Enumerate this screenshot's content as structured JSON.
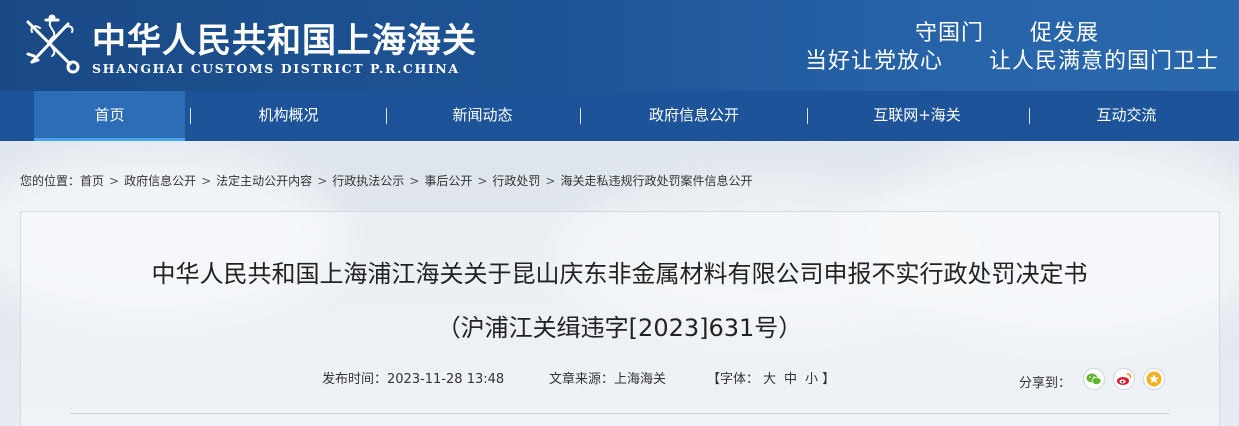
{
  "header": {
    "site_name": "中华人民共和国上海海关",
    "site_name_en": "SHANGHAI CUSTOMS DISTRICT P.R.CHINA",
    "slogan_line1": "守国门　　促发展",
    "slogan_line2": "当好让党放心　　让人民满意的国门卫士"
  },
  "nav": {
    "items": [
      {
        "label": "首页"
      },
      {
        "label": "机构概况"
      },
      {
        "label": "新闻动态"
      },
      {
        "label": "政府信息公开"
      },
      {
        "label": "互联网+海关"
      },
      {
        "label": "互动交流"
      }
    ],
    "separator": "|"
  },
  "breadcrumb": {
    "prefix": "您的位置：",
    "items": [
      "首页",
      "政府信息公开",
      "法定主动公开内容",
      "行政执法公示",
      "事后公开",
      "行政处罚",
      "海关走私违规行政处罚案件信息公开"
    ],
    "arrow": ">"
  },
  "article": {
    "title_line1": "中华人民共和国上海浦江海关关于昆山庆东非金属材料有限公司申报不实行政处罚决定书",
    "title_line2": "（沪浦江关缉违字[2023]631号）",
    "publish_label": "发布时间：",
    "publish_time": "2023-11-28 13:48",
    "source_label": "文章来源：",
    "source": "上海海关",
    "font_label_open": "【字体：",
    "font_large": "大",
    "font_medium": "中",
    "font_small": "小",
    "font_label_close": "】",
    "share_label": "分享到："
  },
  "share": {
    "icons": [
      "wechat-icon",
      "weibo-icon",
      "favorite-star-icon"
    ],
    "colors": {
      "wechat": "#5fb52e",
      "weibo": "#e6162d",
      "star": "#f4b221"
    }
  }
}
